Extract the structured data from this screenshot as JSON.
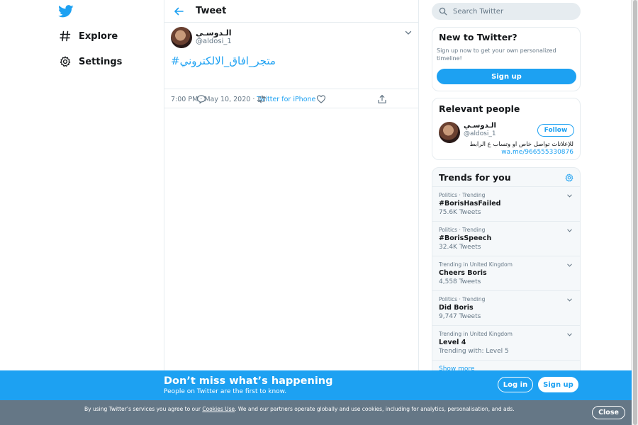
{
  "nav": {
    "logo_icon": "twitter-bird-icon",
    "items": [
      {
        "label": "Explore",
        "icon": "hashtag-icon"
      },
      {
        "label": "Settings",
        "icon": "gear-icon"
      }
    ]
  },
  "header": {
    "title": "Tweet"
  },
  "tweet": {
    "author_name": "الـدوسـي",
    "author_handle": "@aldosi_1",
    "text": "#متجر_افاق_الالكتروني",
    "time": "7:00 PM · May 10, 2020",
    "separator": " · ",
    "source": "Twitter for iPhone"
  },
  "search": {
    "placeholder": "Search Twitter"
  },
  "new_to_twitter": {
    "title": "New to Twitter?",
    "description": "Sign up now to get your own personalized timeline!",
    "button": "Sign up"
  },
  "relevant_people": {
    "title": "Relevant people",
    "name": "الـدوسـي",
    "handle": "@aldosi_1",
    "follow_label": "Follow",
    "bio": "للإعلانات تواصل خاص او وتساب ع الرابط",
    "link": "wa.me/966555330876"
  },
  "trends": {
    "title": "Trends for you",
    "items": [
      {
        "context": "Politics · Trending",
        "name": "#BorisHasFailed",
        "count": "75.6K Tweets"
      },
      {
        "context": "Politics · Trending",
        "name": "#BorisSpeech",
        "count": "32.4K Tweets"
      },
      {
        "context": "Trending in United Kingdom",
        "name": "Cheers Boris",
        "count": "4,558 Tweets"
      },
      {
        "context": "Politics · Trending",
        "name": "Did Boris",
        "count": "9,747 Tweets"
      },
      {
        "context": "Trending in United Kingdom",
        "name": "Level 4",
        "count": "Trending with: Level 5"
      }
    ],
    "show_more": "Show more"
  },
  "banner": {
    "title": "Don’t miss what’s happening",
    "subtitle": "People on Twitter are the first to know.",
    "login": "Log in",
    "signup": "Sign up"
  },
  "cookie": {
    "text_before": "By using Twitter’s services you agree to our ",
    "link": "Cookies Use",
    "text_after": ". We and our partners operate globally and use cookies, including for analytics, personalisation, and ads.",
    "close": "Close"
  },
  "colors": {
    "accent": "#1da1f2",
    "muted": "#657786",
    "border": "#e6ecf0",
    "cookie_bg": "#657786"
  }
}
